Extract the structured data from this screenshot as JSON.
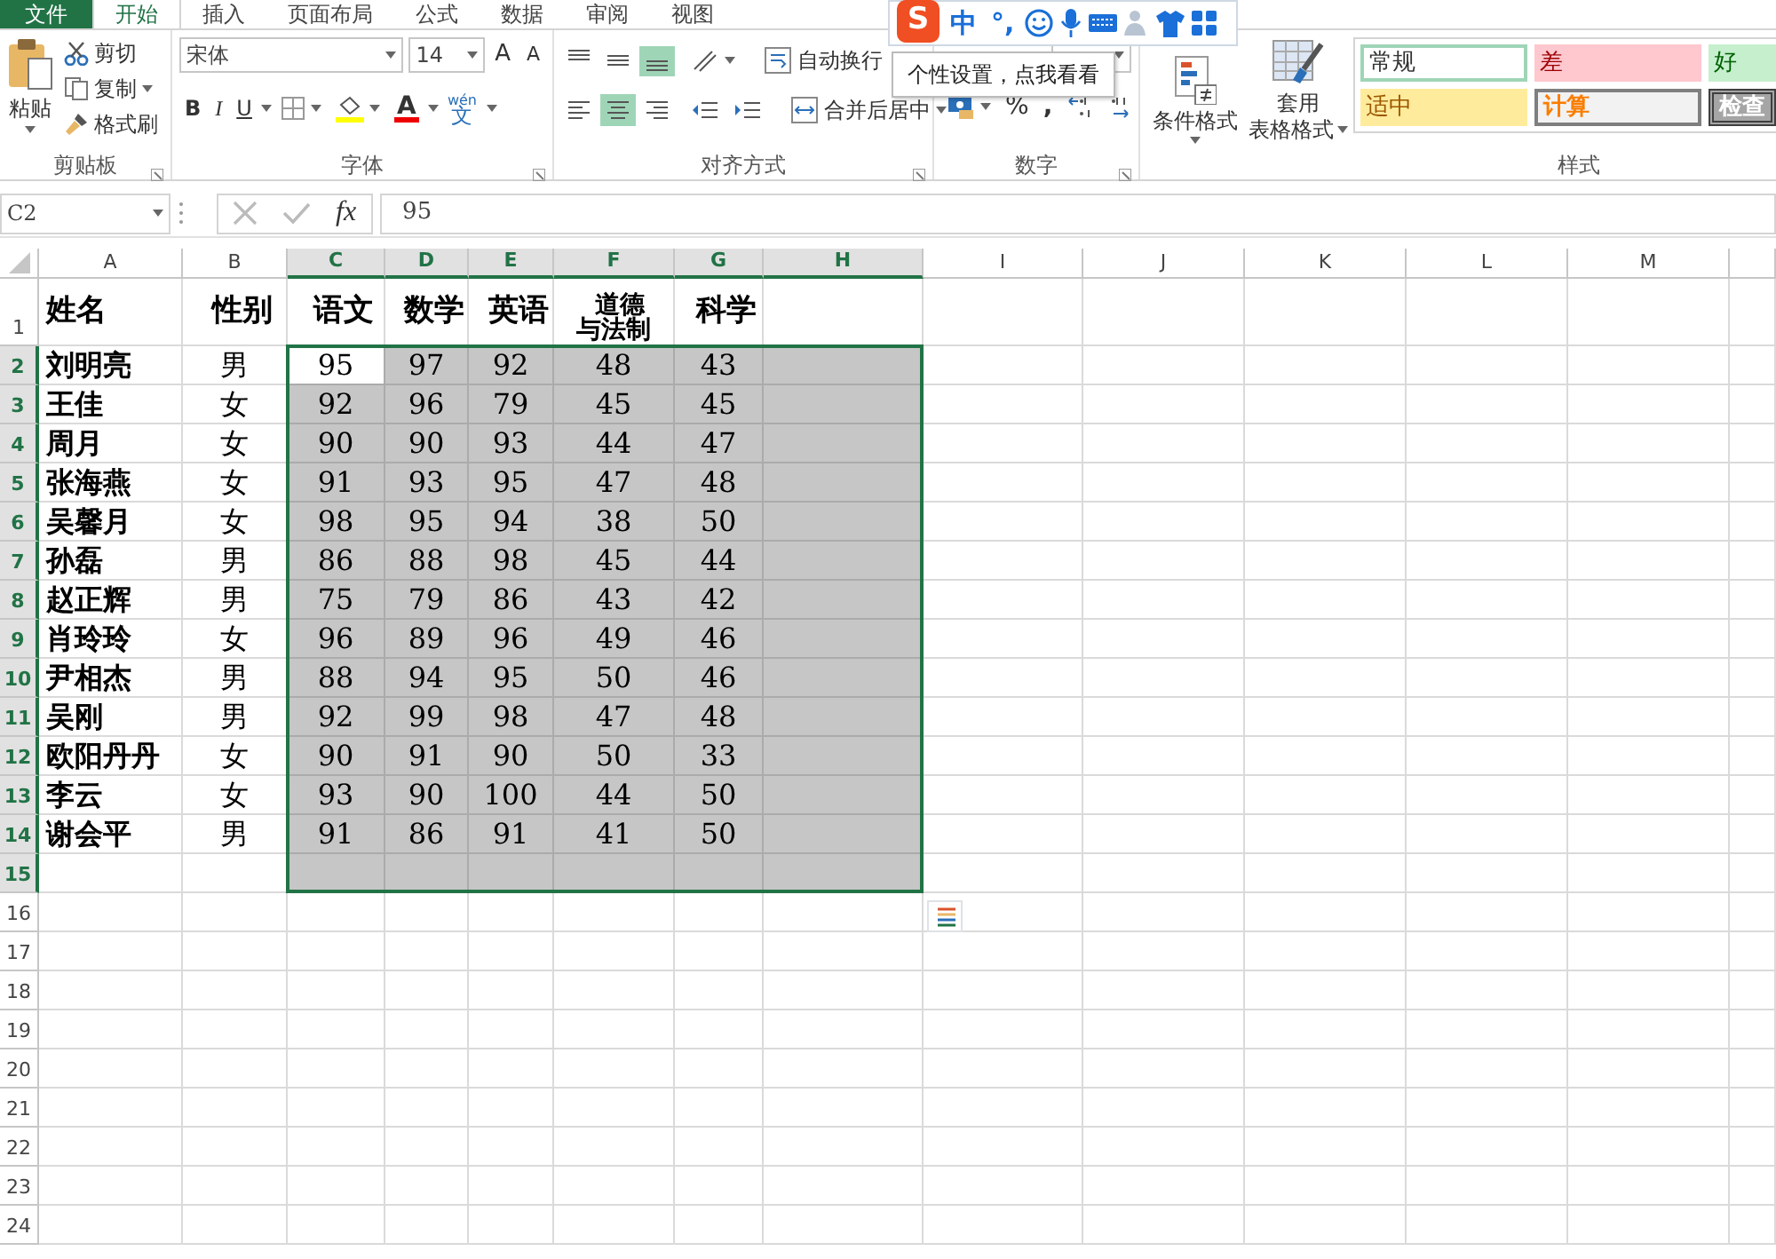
{
  "ribbon_tabs": [
    {
      "label": "文件",
      "kind": "file",
      "selected": false
    },
    {
      "label": "开始",
      "kind": "tab",
      "selected": true
    },
    {
      "label": "插入",
      "kind": "tab",
      "selected": false
    },
    {
      "label": "页面布局",
      "kind": "tab",
      "selected": false
    },
    {
      "label": "公式",
      "kind": "tab",
      "selected": false
    },
    {
      "label": "数据",
      "kind": "tab",
      "selected": false
    },
    {
      "label": "审阅",
      "kind": "tab",
      "selected": false
    },
    {
      "label": "视图",
      "kind": "tab",
      "selected": false
    }
  ],
  "clipboard": {
    "label": "剪贴板",
    "paste": "粘贴",
    "cut": "剪切",
    "copy": "复制",
    "format_painter": "格式刷"
  },
  "font": {
    "label": "字体",
    "font_name": "宋体",
    "font_size": "14",
    "grow": "A",
    "shrink": "A",
    "bold": "B",
    "italic": "I",
    "underline": "U",
    "font_color": "A",
    "phonetic_top": "wén",
    "phonetic": "文"
  },
  "alignment": {
    "label": "对齐方式",
    "buttons": [
      {
        "kind": "top",
        "on": false
      },
      {
        "kind": "middle",
        "on": false
      },
      {
        "kind": "bottom",
        "on": true
      },
      {
        "kind": "left",
        "on": false
      },
      {
        "kind": "center",
        "on": true
      },
      {
        "kind": "right",
        "on": false
      }
    ],
    "wrap": "自动换行",
    "merge": "合并后居中"
  },
  "number": {
    "label": "数字",
    "percent": "%",
    "comma": ","
  },
  "styles": {
    "label": "样式",
    "conditional": "条件格式",
    "table_format_1": "套用",
    "table_format_2": "表格格式",
    "gallery": [
      {
        "text": "常规",
        "kind": "normal"
      },
      {
        "text": "差",
        "kind": "bad"
      },
      {
        "text": "好",
        "kind": "good"
      },
      {
        "text": "适中",
        "kind": "neutral"
      },
      {
        "text": "计算",
        "kind": "calculation"
      },
      {
        "text": "检查",
        "kind": "check"
      }
    ]
  },
  "ime_toolbar": [
    {
      "kind": "logo",
      "text": "S"
    },
    {
      "kind": "text",
      "text": "中"
    },
    {
      "kind": "text",
      "text": "°,"
    },
    {
      "kind": "smiley"
    },
    {
      "kind": "mic"
    },
    {
      "kind": "keyboard"
    },
    {
      "kind": "person"
    },
    {
      "kind": "shirt"
    },
    {
      "kind": "grid"
    }
  ],
  "tooltip": "个性设置，点我看看",
  "formula_bar": {
    "name_box": "C2",
    "fx": "fx",
    "value": "95"
  },
  "sheet": {
    "columns": [
      {
        "letter": "A",
        "selected": false
      },
      {
        "letter": "B",
        "selected": false
      },
      {
        "letter": "C",
        "selected": true,
        "active": true
      },
      {
        "letter": "D",
        "selected": true
      },
      {
        "letter": "E",
        "selected": true
      },
      {
        "letter": "F",
        "selected": true
      },
      {
        "letter": "G",
        "selected": true
      },
      {
        "letter": "H",
        "selected": true
      },
      {
        "letter": "I",
        "selected": false
      },
      {
        "letter": "J",
        "selected": false
      },
      {
        "letter": "K",
        "selected": false
      },
      {
        "letter": "L",
        "selected": false
      },
      {
        "letter": "M",
        "selected": false
      }
    ],
    "rows": [
      {
        "number": "1",
        "kind": "header",
        "selected": false,
        "cells": [
          "姓名",
          "性别",
          "语文",
          "数学",
          "英语",
          "道德与法制",
          "科学"
        ]
      },
      {
        "number": "2",
        "kind": "data",
        "selected": true,
        "active": true,
        "cells": [
          "刘明亮",
          "男",
          "95",
          "97",
          "92",
          "48",
          "43"
        ]
      },
      {
        "number": "3",
        "kind": "data",
        "selected": true,
        "cells": [
          "王佳",
          "女",
          "92",
          "96",
          "79",
          "45",
          "45"
        ]
      },
      {
        "number": "4",
        "kind": "data",
        "selected": true,
        "cells": [
          "周月",
          "女",
          "90",
          "90",
          "93",
          "44",
          "47"
        ]
      },
      {
        "number": "5",
        "kind": "data",
        "selected": true,
        "cells": [
          "张海燕",
          "女",
          "91",
          "93",
          "95",
          "47",
          "48"
        ]
      },
      {
        "number": "6",
        "kind": "data",
        "selected": true,
        "cells": [
          "吴馨月",
          "女",
          "98",
          "95",
          "94",
          "38",
          "50"
        ]
      },
      {
        "number": "7",
        "kind": "data",
        "selected": true,
        "cells": [
          "孙磊",
          "男",
          "86",
          "88",
          "98",
          "45",
          "44"
        ]
      },
      {
        "number": "8",
        "kind": "data",
        "selected": true,
        "cells": [
          "赵正辉",
          "男",
          "75",
          "79",
          "86",
          "43",
          "42"
        ]
      },
      {
        "number": "9",
        "kind": "data",
        "selected": true,
        "cells": [
          "肖玲玲",
          "女",
          "96",
          "89",
          "96",
          "49",
          "46"
        ]
      },
      {
        "number": "10",
        "kind": "data",
        "selected": true,
        "cells": [
          "尹相杰",
          "男",
          "88",
          "94",
          "95",
          "50",
          "46"
        ]
      },
      {
        "number": "11",
        "kind": "data",
        "selected": true,
        "cells": [
          "吴刚",
          "男",
          "92",
          "99",
          "98",
          "47",
          "48"
        ]
      },
      {
        "number": "12",
        "kind": "data",
        "selected": true,
        "cells": [
          "欧阳丹丹",
          "女",
          "90",
          "91",
          "90",
          "50",
          "33"
        ]
      },
      {
        "number": "13",
        "kind": "data",
        "selected": true,
        "cells": [
          "李云",
          "女",
          "93",
          "90",
          "100",
          "44",
          "50"
        ]
      },
      {
        "number": "14",
        "kind": "data",
        "selected": true,
        "cells": [
          "谢会平",
          "男",
          "91",
          "86",
          "91",
          "41",
          "50"
        ]
      },
      {
        "number": "15",
        "kind": "data",
        "selected": true
      },
      {
        "number": "16",
        "kind": "data",
        "selected": false
      },
      {
        "number": "17",
        "kind": "data",
        "selected": false
      },
      {
        "number": "18",
        "kind": "data",
        "selected": false
      },
      {
        "number": "19",
        "kind": "data",
        "selected": false
      },
      {
        "number": "20",
        "kind": "data",
        "selected": false
      },
      {
        "number": "21",
        "kind": "data",
        "selected": false
      },
      {
        "number": "22",
        "kind": "data",
        "selected": false
      },
      {
        "number": "23",
        "kind": "data",
        "selected": false
      },
      {
        "number": "24",
        "kind": "data",
        "selected": false
      }
    ]
  }
}
